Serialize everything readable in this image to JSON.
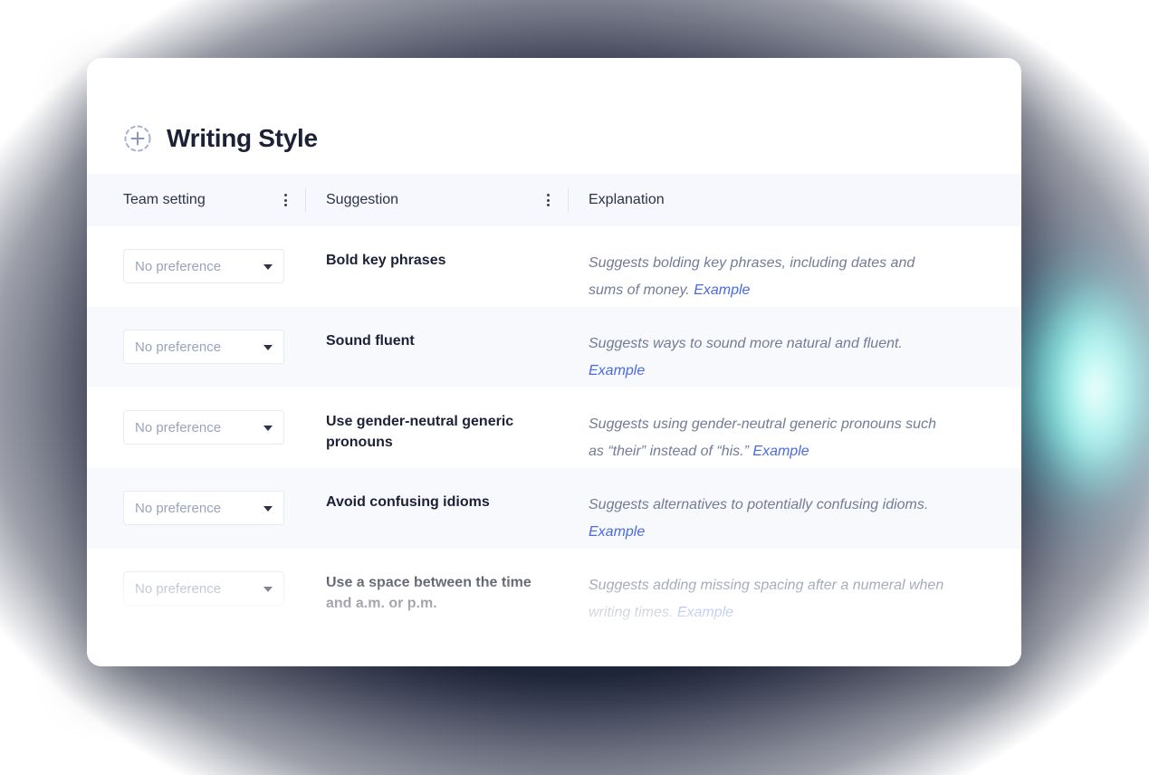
{
  "card": {
    "title": "Writing Style",
    "add_icon": "dashed-circle-plus-icon"
  },
  "table": {
    "headers": [
      {
        "label": "Team setting",
        "menu_icon": "kebab-menu-icon"
      },
      {
        "label": "Suggestion",
        "menu_icon": "kebab-menu-icon"
      },
      {
        "label": "Explanation",
        "menu_icon": ""
      }
    ],
    "select_value": "No preference",
    "example_label": "Example",
    "rows": [
      {
        "setting": "No preference",
        "suggestion": "Bold key phrases",
        "explanation": "Suggests bolding key phrases, including dates and sums of money.",
        "example": "Example"
      },
      {
        "setting": "No preference",
        "suggestion": "Sound fluent",
        "explanation": "Suggests ways to sound more natural and fluent.",
        "example": "Example"
      },
      {
        "setting": "No preference",
        "suggestion": "Use gender-neutral generic pronouns",
        "explanation": "Suggests using gender-neutral generic pronouns such as “their” instead of “his.”",
        "example": "Example"
      },
      {
        "setting": "No preference",
        "suggestion": "Avoid confusing idioms",
        "explanation": "Suggests alternatives to potentially confusing idioms.",
        "example": "Example"
      },
      {
        "setting": "No preference",
        "suggestion": "Use a space between the time and a.m. or p.m.",
        "explanation": "Suggests adding missing spacing after a numeral when writing times.",
        "example": "Example"
      }
    ]
  },
  "colors": {
    "backdrop": "#242a41",
    "card": "#ffffff",
    "header_row": "#f6f8fd",
    "alt_row": "#f7f9fd",
    "title_text": "#1d2135",
    "muted_text": "#727c96",
    "link": "#4a6ae0",
    "glow": "#8ef0e6"
  }
}
